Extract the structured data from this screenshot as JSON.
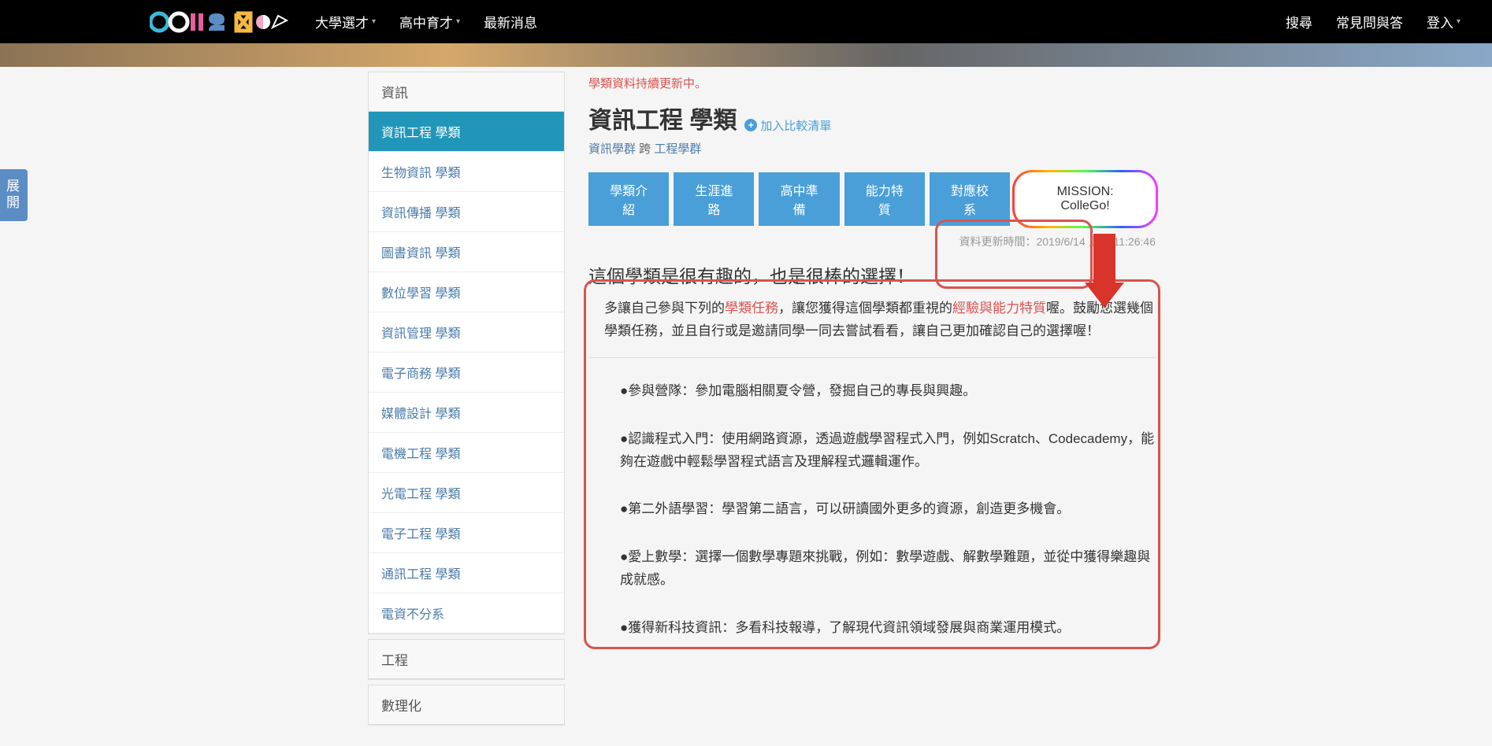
{
  "header": {
    "nav": [
      {
        "label": "大學選才",
        "dropdown": true
      },
      {
        "label": "高中育才",
        "dropdown": true
      },
      {
        "label": "最新消息",
        "dropdown": false
      }
    ],
    "nav_right": [
      {
        "label": "搜尋",
        "dropdown": false
      },
      {
        "label": "常見問與答",
        "dropdown": false
      },
      {
        "label": "登入",
        "dropdown": true
      }
    ]
  },
  "expand_tab": "展開",
  "sidebar": {
    "groups": [
      {
        "title": "資訊",
        "items": [
          {
            "label": "資訊工程 學類",
            "active": true
          },
          {
            "label": "生物資訊 學類"
          },
          {
            "label": "資訊傳播 學類"
          },
          {
            "label": "圖書資訊 學類"
          },
          {
            "label": "數位學習 學類"
          },
          {
            "label": "資訊管理 學類"
          },
          {
            "label": "電子商務 學類"
          },
          {
            "label": "媒體設計 學類"
          },
          {
            "label": "電機工程 學類"
          },
          {
            "label": "光電工程 學類"
          },
          {
            "label": "電子工程 學類"
          },
          {
            "label": "通訊工程 學類"
          },
          {
            "label": "電資不分系"
          }
        ]
      },
      {
        "title": "工程",
        "items": []
      },
      {
        "title": "數理化",
        "items": []
      }
    ]
  },
  "main": {
    "notice": "學類資料持續更新中。",
    "title": "資訊工程 學類",
    "add_compare": "加入比較清單",
    "breadcrumb": {
      "group1": "資訊學群",
      "join": " 跨 ",
      "group2": "工程學群"
    },
    "tabs": [
      "學類介紹",
      "生涯進路",
      "高中準備",
      "能力特質",
      "對應校系",
      "MISSION: ColleGo!"
    ],
    "update_time": "資料更新時間：2019/6/14 上午 11:26:46",
    "content_title": "這個學類是很有趣的，也是很棒的選擇！",
    "content_sub": {
      "p1a": "多讓自己參與下列的",
      "p1b": "學類任務",
      "p1c": "，讓您獲得這個學類都重視的",
      "p1d": "經驗與能力特質",
      "p1e": "喔。鼓勵您選幾個學類任務，並且自行或是邀請同學一同去嘗試看看，讓自己更加確認自己的選擇喔！"
    },
    "missions": [
      "●參與營隊：參加電腦相關夏令營，發掘自己的專長與興趣。",
      "●認識程式入門：使用網路資源，透過遊戲學習程式入門，例如Scratch、Codecademy，能夠在遊戲中輕鬆學習程式語言及理解程式邏輯運作。",
      "●第二外語學習：學習第二語言，可以研讀國外更多的資源，創造更多機會。",
      "●愛上數學：選擇一個數學專題來挑戰，例如：數學遊戲、解數學難題，並從中獲得樂趣與成就感。",
      "●獲得新科技資訊：多看科技報導，了解現代資訊領域發展與商業運用模式。"
    ]
  }
}
